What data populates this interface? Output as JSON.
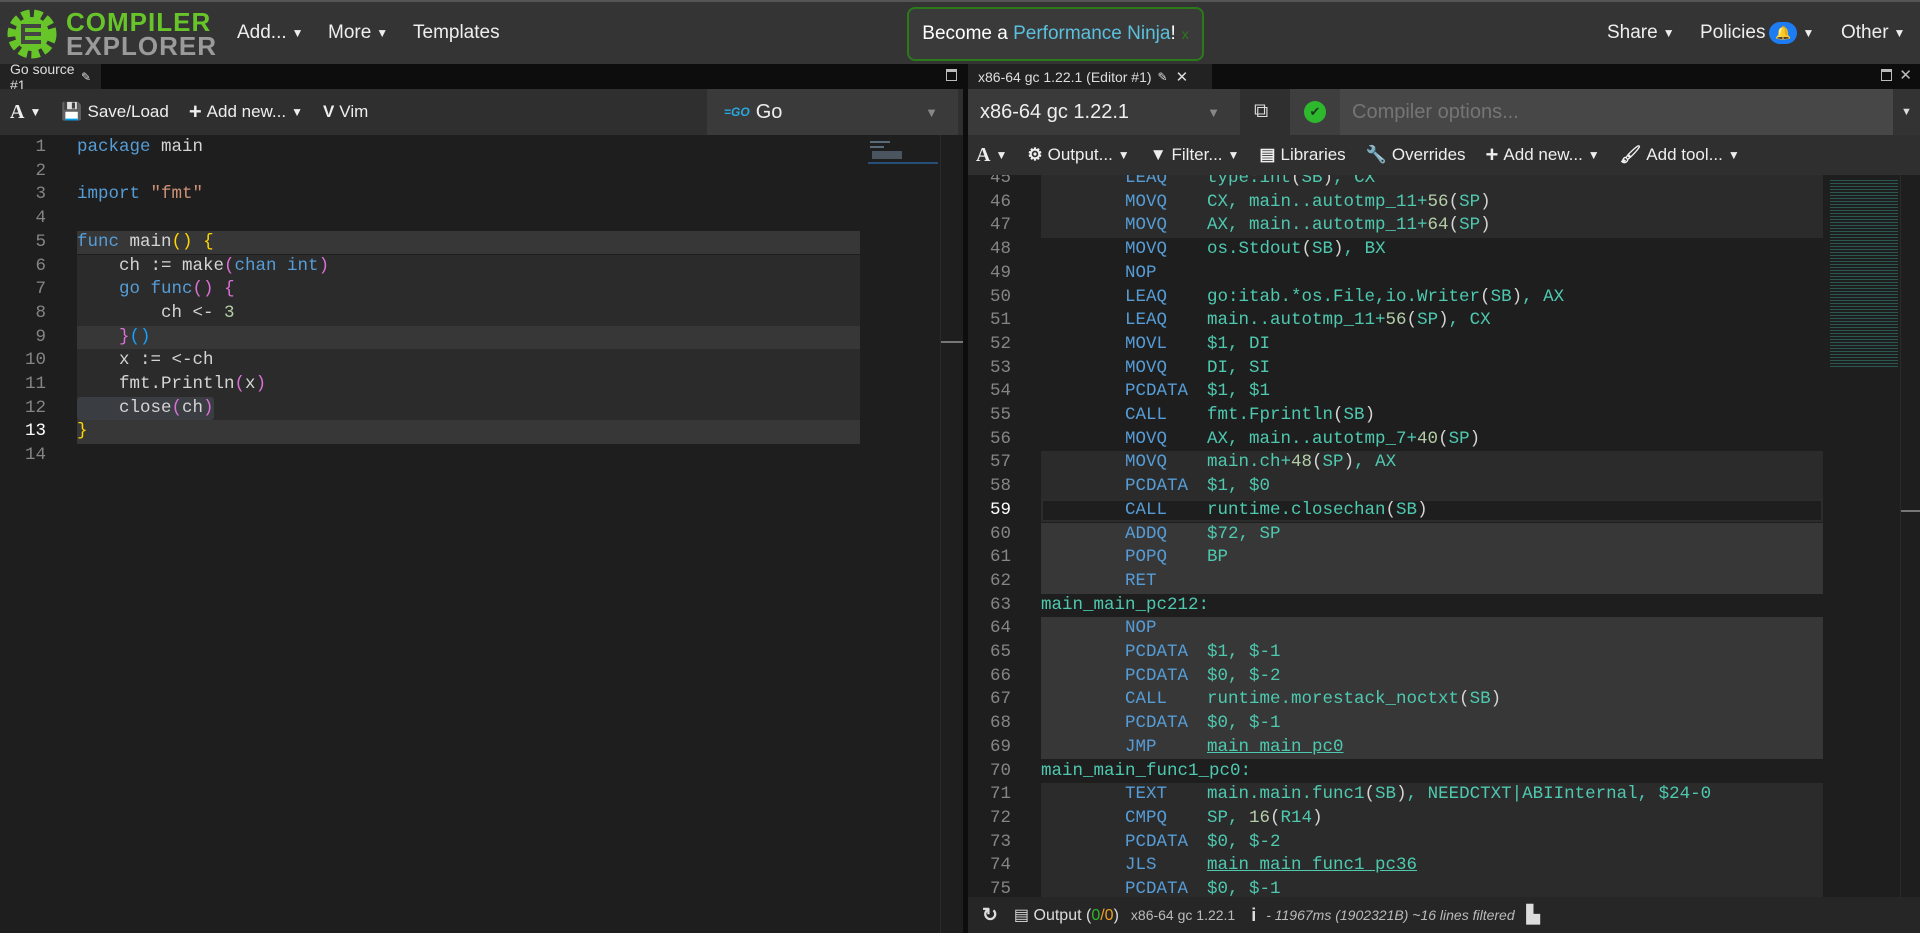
{
  "header": {
    "logo_line1": "COMPILER",
    "logo_line2": "EXPLORER",
    "nav": [
      {
        "label": "Add..."
      },
      {
        "label": "More"
      },
      {
        "label": "Templates"
      }
    ],
    "banner": {
      "prefix": "Become a ",
      "link": "Performance Ninja",
      "suffix": "!",
      "close": "x"
    },
    "right": [
      {
        "label": "Share"
      },
      {
        "label": "Policies"
      },
      {
        "label": "Other"
      }
    ],
    "brand_color": "#67c52a"
  },
  "source_pane": {
    "tab_title": "Go source #1",
    "toolbar": {
      "font": "A",
      "save_load": "Save/Load",
      "add_new": "Add new...",
      "vim": "Vim"
    },
    "language": {
      "icon": "=GO",
      "label": "Go"
    },
    "current_line": 13,
    "lines": [
      {
        "n": "1",
        "hl": 0,
        "t": [
          [
            "package",
            "k"
          ],
          [
            " main",
            "i"
          ]
        ]
      },
      {
        "n": "2",
        "hl": 0,
        "t": []
      },
      {
        "n": "3",
        "hl": 0,
        "t": [
          [
            "import",
            "k"
          ],
          [
            " ",
            "i"
          ],
          [
            "\"fmt\"",
            "s"
          ]
        ]
      },
      {
        "n": "4",
        "hl": 0,
        "t": []
      },
      {
        "n": "5",
        "hl": 2,
        "t": [
          [
            "func",
            "k"
          ],
          [
            " main",
            "i"
          ],
          [
            "()",
            "y"
          ],
          [
            " ",
            "i"
          ],
          [
            "{",
            "y"
          ]
        ]
      },
      {
        "n": "6",
        "hl": 1,
        "t": [
          [
            "    ch := make",
            "i"
          ],
          [
            "(",
            "p"
          ],
          [
            "chan int",
            "k"
          ],
          [
            ")",
            "p"
          ]
        ]
      },
      {
        "n": "7",
        "hl": 1,
        "t": [
          [
            "    ",
            "i"
          ],
          [
            "go func",
            "k"
          ],
          [
            "()",
            "p"
          ],
          [
            " ",
            "i"
          ],
          [
            "{",
            "p"
          ]
        ]
      },
      {
        "n": "8",
        "hl": 1,
        "t": [
          [
            "        ch <- ",
            "i"
          ],
          [
            "3",
            "n"
          ]
        ]
      },
      {
        "n": "9",
        "hl": 2,
        "t": [
          [
            "    ",
            "i"
          ],
          [
            "}",
            "p"
          ],
          [
            "()",
            "b"
          ]
        ]
      },
      {
        "n": "10",
        "hl": 1,
        "t": [
          [
            "    x := <-ch",
            "i"
          ]
        ]
      },
      {
        "n": "11",
        "hl": 1,
        "t": [
          [
            "    fmt.Println",
            "i"
          ],
          [
            "(",
            "p"
          ],
          [
            "x",
            "i"
          ],
          [
            ")",
            "p"
          ]
        ]
      },
      {
        "n": "12",
        "hl": 1,
        "t": [
          [
            "    close",
            "i"
          ],
          [
            "(",
            "p"
          ],
          [
            "ch",
            "i"
          ],
          [
            ")",
            "p"
          ]
        ]
      },
      {
        "n": "13",
        "hl": 2,
        "t": [
          [
            "}",
            "y"
          ]
        ]
      },
      {
        "n": "14",
        "hl": 0,
        "t": []
      }
    ]
  },
  "compiler_pane": {
    "tab_title": "x86-64 gc 1.22.1 (Editor #1)",
    "compiler": "x86-64 gc 1.22.1",
    "options_placeholder": "Compiler options...",
    "status": "ok",
    "toolbar": {
      "font": "A",
      "output": "Output...",
      "filter": "Filter...",
      "libraries": "Libraries",
      "overrides": "Overrides",
      "add_new": "Add new...",
      "add_tool": "Add tool..."
    },
    "current_line": 59,
    "lines": [
      {
        "n": "45",
        "hl": 1,
        "m": "LEAQ",
        "ops": [
          "type:int",
          "(",
          "SB",
          ")",
          ", CX"
        ]
      },
      {
        "n": "46",
        "hl": 1,
        "m": "MOVQ",
        "ops": [
          "CX, main..autotmp_11+",
          "56",
          "(",
          "SP",
          ")"
        ]
      },
      {
        "n": "47",
        "hl": 1,
        "m": "MOVQ",
        "ops": [
          "AX, main..autotmp_11+",
          "64",
          "(",
          "SP",
          ")"
        ]
      },
      {
        "n": "48",
        "hl": 0,
        "m": "MOVQ",
        "ops": [
          "os.Stdout",
          "(",
          "SB",
          ")",
          ", BX"
        ]
      },
      {
        "n": "49",
        "hl": 0,
        "m": "NOP",
        "ops": []
      },
      {
        "n": "50",
        "hl": 0,
        "m": "LEAQ",
        "ops": [
          "go:itab.*os.File,io.Writer",
          "(",
          "SB",
          ")",
          ", AX"
        ]
      },
      {
        "n": "51",
        "hl": 0,
        "m": "LEAQ",
        "ops": [
          "main..autotmp_11+",
          "56",
          "(",
          "SP",
          ")",
          ", CX"
        ]
      },
      {
        "n": "52",
        "hl": 0,
        "m": "MOVL",
        "ops": [
          "$1, DI"
        ]
      },
      {
        "n": "53",
        "hl": 0,
        "m": "MOVQ",
        "ops": [
          "DI, SI"
        ]
      },
      {
        "n": "54",
        "hl": 0,
        "m": "PCDATA",
        "ops": [
          "$1, $1"
        ]
      },
      {
        "n": "55",
        "hl": 0,
        "m": "CALL",
        "ops": [
          "fmt.Fprintln",
          "(",
          "SB",
          ")"
        ]
      },
      {
        "n": "56",
        "hl": 0,
        "m": "MOVQ",
        "ops": [
          "AX, main..autotmp_7+",
          "40",
          "(",
          "SP",
          ")"
        ]
      },
      {
        "n": "57",
        "hl": 1,
        "m": "MOVQ",
        "ops": [
          "main.ch+",
          "48",
          "(",
          "SP",
          ")",
          ", AX"
        ]
      },
      {
        "n": "58",
        "hl": 1,
        "m": "PCDATA",
        "ops": [
          "$1, $0"
        ]
      },
      {
        "n": "59",
        "hl": 3,
        "m": "CALL",
        "ops": [
          "runtime.closechan",
          "(",
          "SB",
          ")"
        ]
      },
      {
        "n": "60",
        "hl": 2,
        "m": "ADDQ",
        "ops": [
          "$72, SP"
        ]
      },
      {
        "n": "61",
        "hl": 2,
        "m": "POPQ",
        "ops": [
          "BP"
        ]
      },
      {
        "n": "62",
        "hl": 2,
        "m": "RET",
        "ops": []
      },
      {
        "n": "63",
        "hl": 0,
        "label": "main_main_pc212:"
      },
      {
        "n": "64",
        "hl": 2,
        "m": "NOP",
        "ops": []
      },
      {
        "n": "65",
        "hl": 2,
        "m": "PCDATA",
        "ops": [
          "$1, $-1"
        ]
      },
      {
        "n": "66",
        "hl": 2,
        "m": "PCDATA",
        "ops": [
          "$0, $-2"
        ]
      },
      {
        "n": "67",
        "hl": 2,
        "m": "CALL",
        "ops": [
          "runtime.morestack_noctxt",
          "(",
          "SB",
          ")"
        ]
      },
      {
        "n": "68",
        "hl": 2,
        "m": "PCDATA",
        "ops": [
          "$0, $-1"
        ]
      },
      {
        "n": "69",
        "hl": 2,
        "m": "JMP",
        "link": "main_main_pc0"
      },
      {
        "n": "70",
        "hl": 0,
        "label": "main_main_func1_pc0:"
      },
      {
        "n": "71",
        "hl": 1,
        "m": "TEXT",
        "ops": [
          "main.main.func1",
          "(",
          "SB",
          ")",
          ", NEEDCTXT|ABIInternal, $24-0"
        ]
      },
      {
        "n": "72",
        "hl": 1,
        "m": "CMPQ",
        "ops": [
          "SP, ",
          "16",
          "(",
          "R14",
          ")"
        ]
      },
      {
        "n": "73",
        "hl": 1,
        "m": "PCDATA",
        "ops": [
          "$0, $-2"
        ]
      },
      {
        "n": "74",
        "hl": 1,
        "m": "JLS",
        "link": "main_main_func1_pc36"
      },
      {
        "n": "75",
        "hl": 1,
        "m": "PCDATA",
        "ops": [
          "$0, $-1"
        ]
      }
    ],
    "bottom": {
      "output_label": "Output (",
      "ok_count": "0",
      "slash": "/",
      "err_count": "0",
      "close_paren": ")",
      "compiler": "x86-64 gc 1.22.1",
      "info": "i",
      "stats": "- 11967ms (1902321B) ~16 lines filtered"
    }
  }
}
